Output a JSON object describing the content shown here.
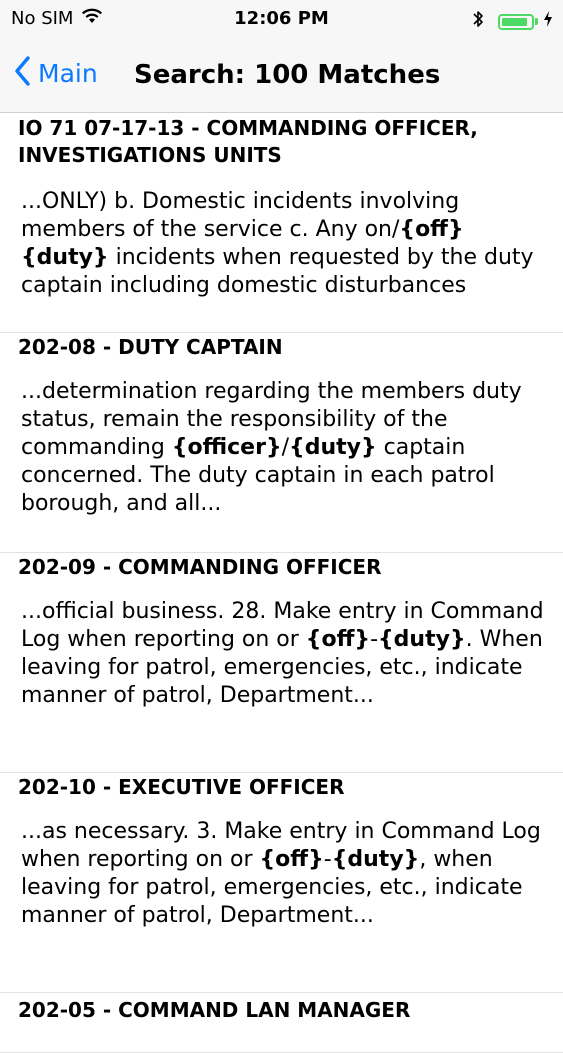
{
  "status_bar": {
    "carrier": "No SIM",
    "time": "12:06 PM",
    "battery_level": 0.9,
    "icons": [
      "wifi-icon",
      "bluetooth-icon",
      "battery-icon",
      "charging-icon"
    ]
  },
  "nav": {
    "back_label": "Main",
    "title": "Search: 100 Matches",
    "accent_color": "#0a7aff"
  },
  "results": [
    {
      "title": "IO 71 07-17-13 - COMMANDING OFFICER, INVESTIGATIONS UNITS",
      "snippet": [
        {
          "t": "...ONLY) b. Domestic incidents involving members of the service c. Any on/"
        },
        {
          "t": "{off}",
          "h": true
        },
        {
          "t": " "
        },
        {
          "t": "{duty}",
          "h": true
        },
        {
          "t": " incidents when requested by the duty captain including domestic disturbances"
        }
      ]
    },
    {
      "title": "202-08 - DUTY CAPTAIN",
      "snippet": [
        {
          "t": "...determination regarding the members duty status, remain the responsibility of the commanding "
        },
        {
          "t": "{officer}",
          "h": true
        },
        {
          "t": "/"
        },
        {
          "t": "{duty}",
          "h": true
        },
        {
          "t": " captain concerned. The duty captain in each patrol borough, and all..."
        }
      ]
    },
    {
      "title": "202-09 - COMMANDING OFFICER",
      "snippet": [
        {
          "t": "...official business. 28. Make entry in Command Log when reporting on or "
        },
        {
          "t": "{off}",
          "h": true
        },
        {
          "t": "-"
        },
        {
          "t": "{duty}",
          "h": true
        },
        {
          "t": ". When leaving for patrol, emergencies, etc., indicate manner of patrol, Department..."
        }
      ]
    },
    {
      "title": "202-10 - EXECUTIVE OFFICER",
      "snippet": [
        {
          "t": "...as necessary. 3. Make entry in Command Log when reporting on or "
        },
        {
          "t": "{off}",
          "h": true
        },
        {
          "t": "-"
        },
        {
          "t": "{duty}",
          "h": true
        },
        {
          "t": ", when leaving for patrol, emergencies, etc., indicate manner of patrol, Department..."
        }
      ]
    },
    {
      "title": "202-05 - COMMAND LAN MANAGER",
      "snippet": []
    }
  ]
}
